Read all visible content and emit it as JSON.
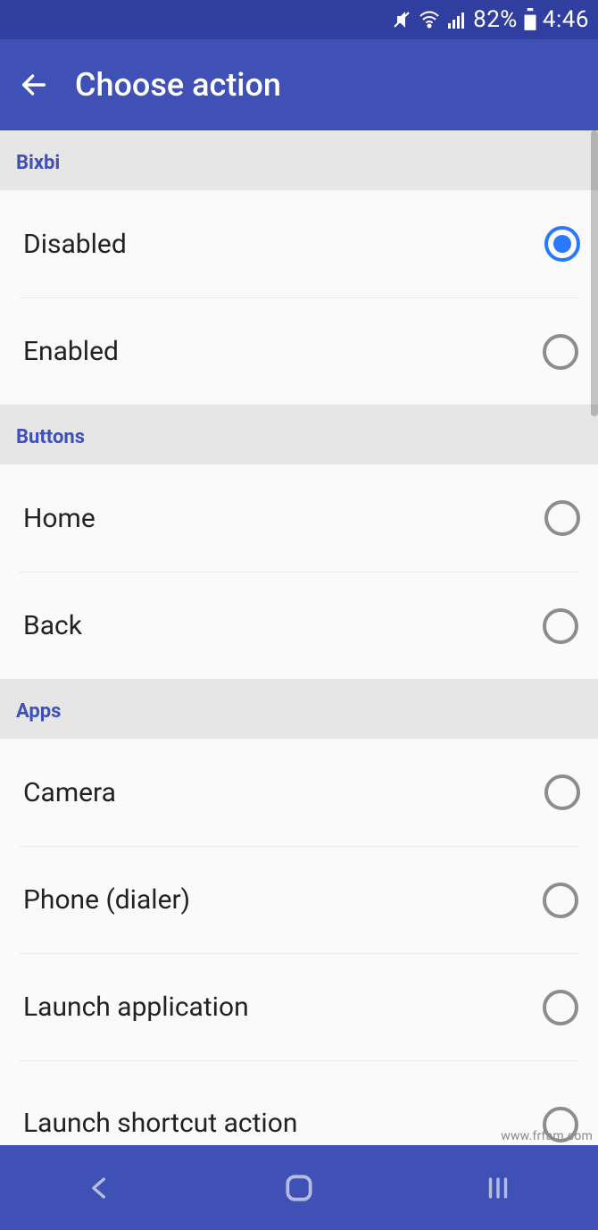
{
  "status": {
    "battery": "82%",
    "time": "4:46"
  },
  "header": {
    "title": "Choose action"
  },
  "sections": [
    {
      "title": "Bixbi",
      "items": [
        {
          "label": "Disabled",
          "selected": true
        },
        {
          "label": "Enabled",
          "selected": false
        }
      ]
    },
    {
      "title": "Buttons",
      "items": [
        {
          "label": "Home",
          "selected": false
        },
        {
          "label": "Back",
          "selected": false
        }
      ]
    },
    {
      "title": "Apps",
      "items": [
        {
          "label": "Camera",
          "selected": false
        },
        {
          "label": "Phone (dialer)",
          "selected": false
        },
        {
          "label": "Launch application",
          "selected": false
        },
        {
          "label": "Launch shortcut action",
          "selected": false
        }
      ]
    }
  ],
  "watermark": "www.frfam.com"
}
